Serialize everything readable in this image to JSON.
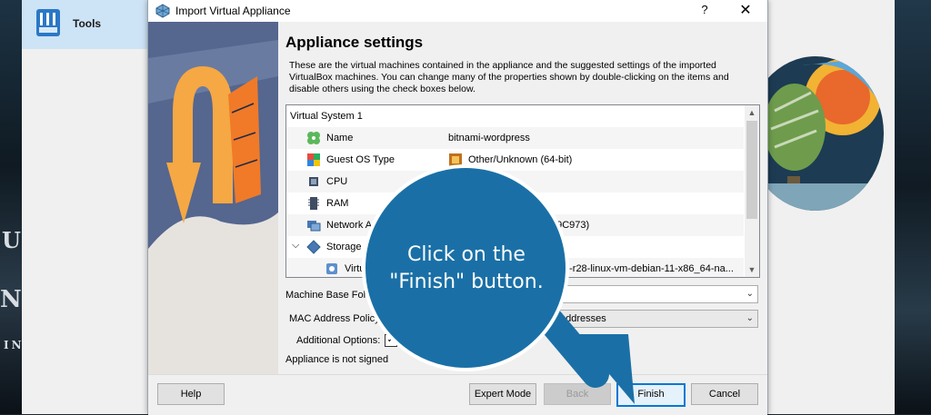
{
  "background": {
    "tools_label": "Tools",
    "left_edge_glyphs": [
      "U",
      "NT",
      "IN"
    ]
  },
  "dialog": {
    "title": "Import Virtual Appliance",
    "help_button": "?",
    "close_button": "✕",
    "heading": "Appliance settings",
    "description": "These are the virtual machines contained in the appliance and the suggested settings of the imported VirtualBox machines. You can change many of the properties shown by double-clicking on the items and disable others using the check boxes below.",
    "tree": {
      "system_label": "Virtual System 1",
      "rows": [
        {
          "label": "Name",
          "value": "bitnami-wordpress",
          "icon": "name-icon"
        },
        {
          "label": "Guest OS Type",
          "value": "Other/Unknown (64-bit)",
          "icon": "os-type-icon"
        },
        {
          "label": "CPU",
          "value": "",
          "icon": "cpu-icon"
        },
        {
          "label": "RAM",
          "value": "",
          "icon": "ram-icon"
        },
        {
          "label": "Network Ad",
          "value": "79C973)",
          "icon": "network-icon"
        },
        {
          "label": "Storage C",
          "value": "",
          "icon": "storage-icon"
        },
        {
          "label": "Virtua",
          "value": "0-r28-linux-vm-debian-11-x86_64-na...",
          "icon": "disk-icon"
        }
      ]
    },
    "form": {
      "machine_base_folder_label": "Machine Base Folde",
      "machine_base_folder_value": "",
      "mac_policy_label": "MAC Address Policy:",
      "mac_policy_value": "addresses",
      "additional_options_label": "Additional Options:",
      "additional_options_checked": true,
      "signature_status": "Appliance is not signed"
    },
    "buttons": {
      "help": "Help",
      "expert_mode": "Expert Mode",
      "back": "Back",
      "finish": "Finish",
      "cancel": "Cancel"
    }
  },
  "callout": {
    "line1": "Click on the",
    "line2": "\"Finish\" button.",
    "color": "#1a70a6"
  }
}
